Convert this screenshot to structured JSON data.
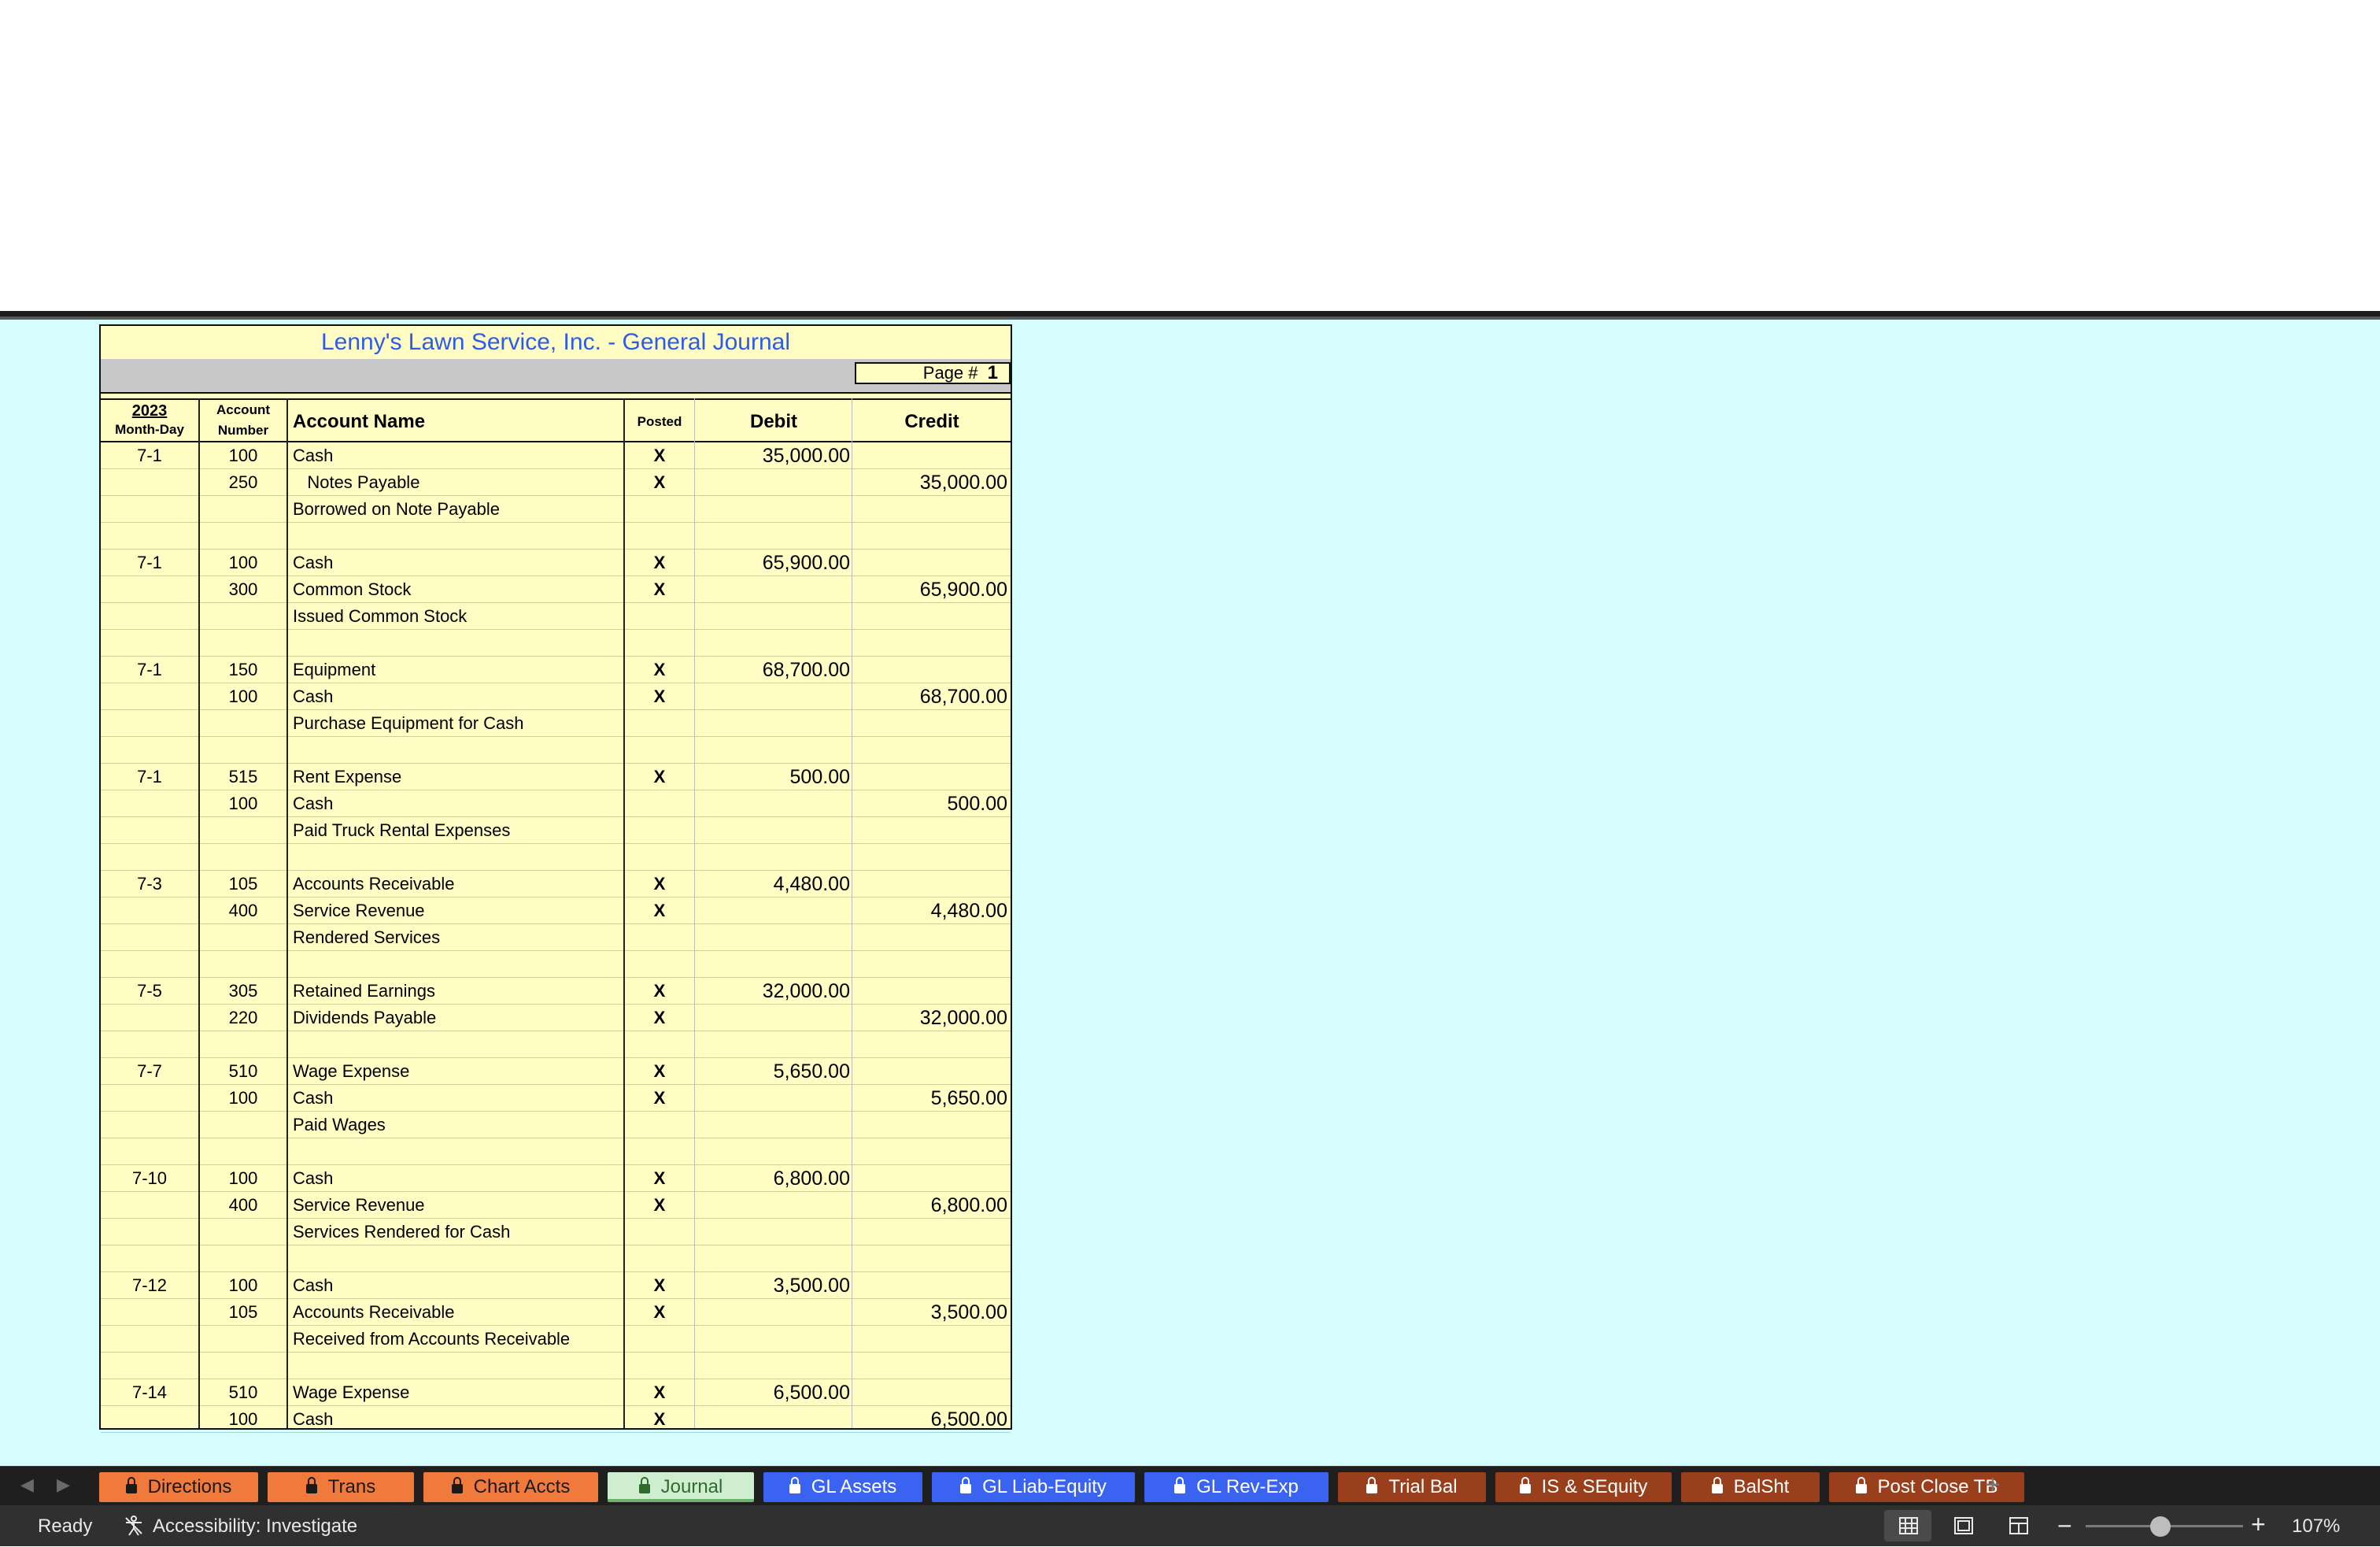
{
  "journal": {
    "title": "Lenny's Lawn Service, Inc.  -  General Journal",
    "page_label": "Page #",
    "page_number": "1",
    "headers": {
      "year": "2023",
      "month_day": "Month-Day",
      "account": "Account",
      "number": "Number",
      "account_name": "Account Name",
      "posted": "Posted",
      "debit": "Debit",
      "credit": "Credit"
    },
    "rows": [
      {
        "date": "7-1",
        "acct": "100",
        "name": "Cash",
        "posted": "X",
        "debit": "35,000.00",
        "credit": ""
      },
      {
        "date": "",
        "acct": "250",
        "name": "   Notes Payable",
        "posted": "X",
        "debit": "",
        "credit": "35,000.00"
      },
      {
        "date": "",
        "acct": "",
        "name": "Borrowed on Note Payable",
        "posted": "",
        "debit": "",
        "credit": ""
      },
      {
        "date": "",
        "acct": "",
        "name": "",
        "posted": "",
        "debit": "",
        "credit": ""
      },
      {
        "date": "7-1",
        "acct": "100",
        "name": "Cash",
        "posted": "X",
        "debit": "65,900.00",
        "credit": ""
      },
      {
        "date": "",
        "acct": "300",
        "name": "Common Stock",
        "posted": "X",
        "debit": "",
        "credit": "65,900.00"
      },
      {
        "date": "",
        "acct": "",
        "name": "Issued Common Stock",
        "posted": "",
        "debit": "",
        "credit": ""
      },
      {
        "date": "",
        "acct": "",
        "name": "",
        "posted": "",
        "debit": "",
        "credit": ""
      },
      {
        "date": "7-1",
        "acct": "150",
        "name": "Equipment",
        "posted": "X",
        "debit": "68,700.00",
        "credit": ""
      },
      {
        "date": "",
        "acct": "100",
        "name": "Cash",
        "posted": "X",
        "debit": "",
        "credit": "68,700.00"
      },
      {
        "date": "",
        "acct": "",
        "name": "Purchase Equipment for Cash",
        "posted": "",
        "debit": "",
        "credit": ""
      },
      {
        "date": "",
        "acct": "",
        "name": "",
        "posted": "",
        "debit": "",
        "credit": ""
      },
      {
        "date": "7-1",
        "acct": "515",
        "name": "Rent Expense",
        "posted": "X",
        "debit": "500.00",
        "credit": ""
      },
      {
        "date": "",
        "acct": "100",
        "name": "Cash",
        "posted": "",
        "debit": "",
        "credit": "500.00"
      },
      {
        "date": "",
        "acct": "",
        "name": "Paid Truck Rental Expenses",
        "posted": "",
        "debit": "",
        "credit": ""
      },
      {
        "date": "",
        "acct": "",
        "name": "",
        "posted": "",
        "debit": "",
        "credit": ""
      },
      {
        "date": "7-3",
        "acct": "105",
        "name": "Accounts Receivable",
        "posted": "X",
        "debit": "4,480.00",
        "credit": ""
      },
      {
        "date": "",
        "acct": "400",
        "name": "Service Revenue",
        "posted": "X",
        "debit": "",
        "credit": "4,480.00"
      },
      {
        "date": "",
        "acct": "",
        "name": "Rendered Services",
        "posted": "",
        "debit": "",
        "credit": ""
      },
      {
        "date": "",
        "acct": "",
        "name": "",
        "posted": "",
        "debit": "",
        "credit": ""
      },
      {
        "date": "7-5",
        "acct": "305",
        "name": "Retained Earnings",
        "posted": "X",
        "debit": "32,000.00",
        "credit": ""
      },
      {
        "date": "",
        "acct": "220",
        "name": "Dividends Payable",
        "posted": "X",
        "debit": "",
        "credit": "32,000.00"
      },
      {
        "date": "",
        "acct": "",
        "name": "",
        "posted": "",
        "debit": "",
        "credit": ""
      },
      {
        "date": "7-7",
        "acct": "510",
        "name": "Wage Expense",
        "posted": "X",
        "debit": "5,650.00",
        "credit": ""
      },
      {
        "date": "",
        "acct": "100",
        "name": "Cash",
        "posted": "X",
        "debit": "",
        "credit": "5,650.00"
      },
      {
        "date": "",
        "acct": "",
        "name": "Paid Wages",
        "posted": "",
        "debit": "",
        "credit": ""
      },
      {
        "date": "",
        "acct": "",
        "name": "",
        "posted": "",
        "debit": "",
        "credit": ""
      },
      {
        "date": "7-10",
        "acct": "100",
        "name": "Cash",
        "posted": "X",
        "debit": "6,800.00",
        "credit": ""
      },
      {
        "date": "",
        "acct": "400",
        "name": "Service Revenue",
        "posted": "X",
        "debit": "",
        "credit": "6,800.00"
      },
      {
        "date": "",
        "acct": "",
        "name": "Services Rendered for Cash",
        "posted": "",
        "debit": "",
        "credit": ""
      },
      {
        "date": "",
        "acct": "",
        "name": "",
        "posted": "",
        "debit": "",
        "credit": ""
      },
      {
        "date": "7-12",
        "acct": "100",
        "name": "Cash",
        "posted": "X",
        "debit": "3,500.00",
        "credit": ""
      },
      {
        "date": "",
        "acct": "105",
        "name": "Accounts Receivable",
        "posted": "X",
        "debit": "",
        "credit": "3,500.00"
      },
      {
        "date": "",
        "acct": "",
        "name": "Received from Accounts Receivable",
        "posted": "",
        "debit": "",
        "credit": ""
      },
      {
        "date": "",
        "acct": "",
        "name": "",
        "posted": "",
        "debit": "",
        "credit": ""
      },
      {
        "date": "7-14",
        "acct": "510",
        "name": "Wage Expense",
        "posted": "X",
        "debit": "6,500.00",
        "credit": ""
      },
      {
        "date": "",
        "acct": "100",
        "name": "Cash",
        "posted": "X",
        "debit": "",
        "credit": "6,500.00"
      }
    ]
  },
  "tabs": [
    {
      "label": "Directions",
      "style": "orange",
      "locked": true,
      "active": false
    },
    {
      "label": "Trans",
      "style": "orange",
      "locked": true,
      "active": false
    },
    {
      "label": "Chart Accts",
      "style": "orange",
      "locked": true,
      "active": false
    },
    {
      "label": "Journal",
      "style": "active",
      "locked": true,
      "active": true
    },
    {
      "label": "GL Assets",
      "style": "blue",
      "locked": true,
      "active": false
    },
    {
      "label": "GL Liab-Equity",
      "style": "blue",
      "locked": true,
      "active": false
    },
    {
      "label": "GL Rev-Exp",
      "style": "blue",
      "locked": true,
      "active": false
    },
    {
      "label": "Trial Bal",
      "style": "brown",
      "locked": true,
      "active": false
    },
    {
      "label": "IS & SEquity",
      "style": "brown",
      "locked": true,
      "active": false
    },
    {
      "label": "BalSht",
      "style": "brown",
      "locked": true,
      "active": false
    },
    {
      "label": "Post Close TB",
      "style": "brown",
      "locked": true,
      "active": false
    }
  ],
  "status": {
    "ready": "Ready",
    "accessibility": "Accessibility: Investigate",
    "zoom": "107%"
  },
  "colors": {
    "sheet_bg": "#d6fdfd",
    "journal_bg": "#fffcc4",
    "title_blue": "#2c5bf0",
    "tab_orange": "#f07a3b",
    "tab_blue": "#3b63f2",
    "tab_brown": "#9a3f1c"
  }
}
